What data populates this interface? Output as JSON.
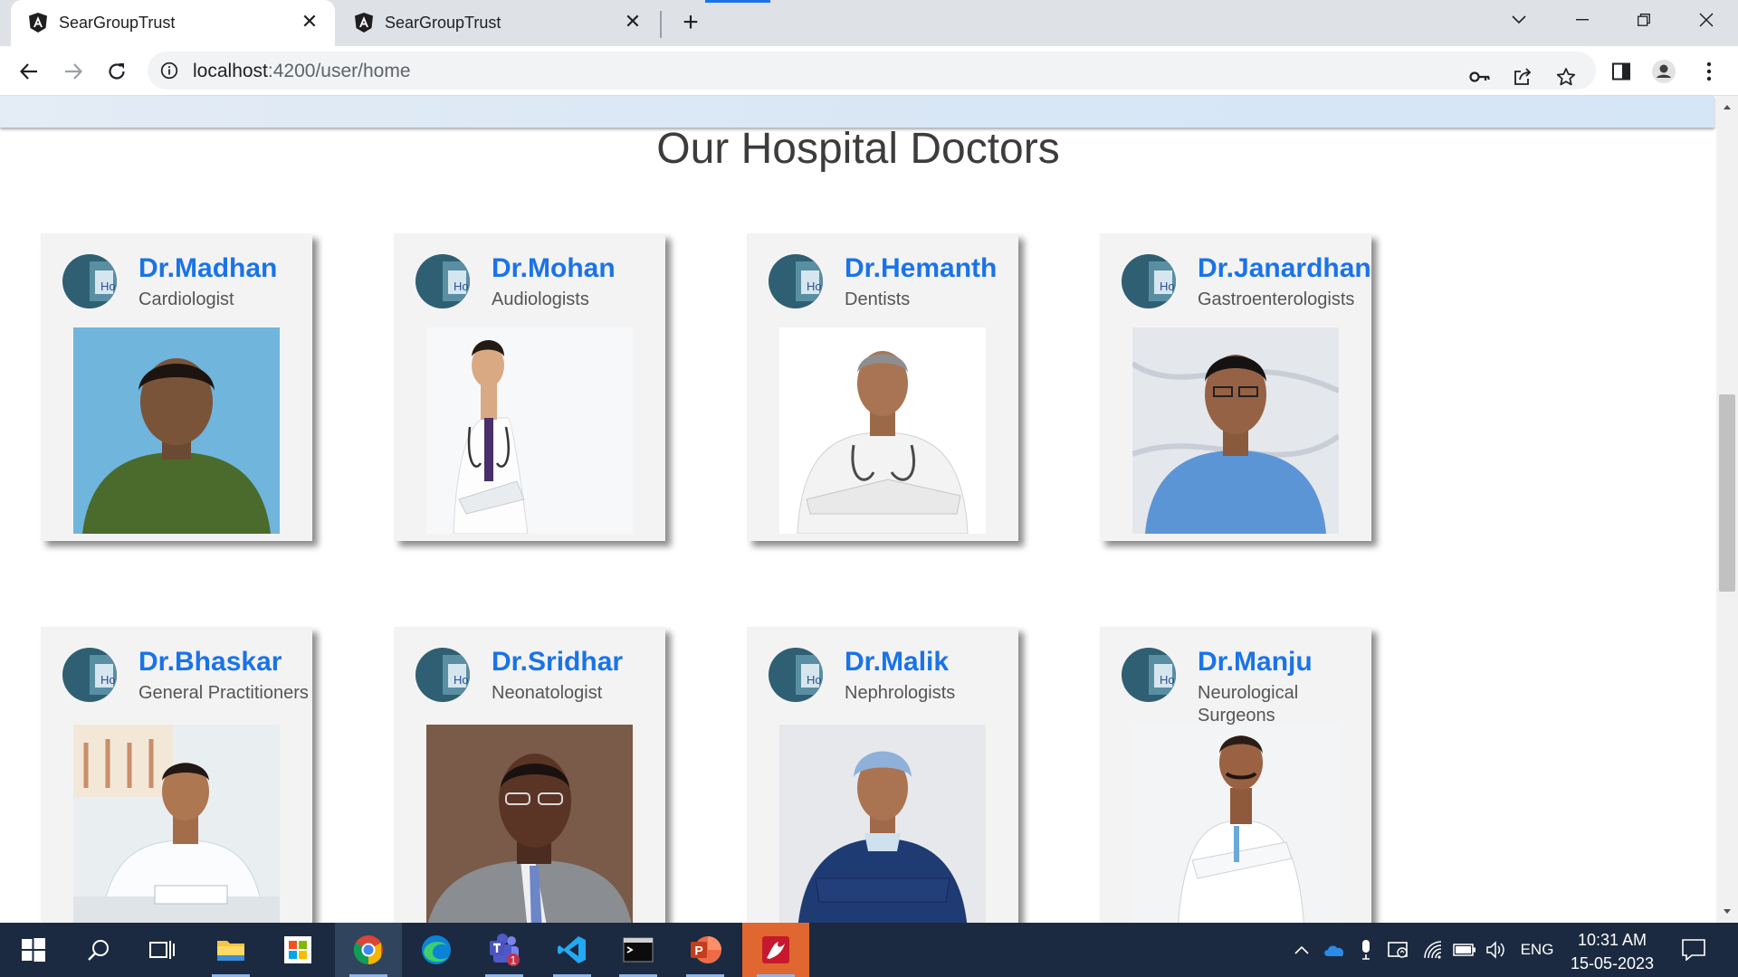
{
  "browser": {
    "tabs": [
      {
        "title": "SearGroupTrust",
        "active": true,
        "favicon": "angular-icon"
      },
      {
        "title": "SearGroupTrust",
        "active": false,
        "favicon": "angular-icon"
      }
    ],
    "url_host": "localhost",
    "url_path": ":4200/user/home"
  },
  "page": {
    "section_title": "Our Hospital Doctors",
    "doctors": [
      {
        "name": "Dr.Madhan",
        "specialty": "Cardiologist"
      },
      {
        "name": "Dr.Mohan",
        "specialty": "Audiologists"
      },
      {
        "name": "Dr.Hemanth",
        "specialty": "Dentists"
      },
      {
        "name": "Dr.Janardhan",
        "specialty": "Gastroenterologists"
      },
      {
        "name": "Dr.Bhaskar",
        "specialty": "General Practitioners"
      },
      {
        "name": "Dr.Sridhar",
        "specialty": "Neonatologist"
      },
      {
        "name": "Dr.Malik",
        "specialty": "Nephrologists"
      },
      {
        "name": "Dr.Manju",
        "specialty": "Neurological Surgeons"
      }
    ],
    "avatar_label": "Hosp"
  },
  "taskbar": {
    "apps": [
      "windows-start-icon",
      "search-icon",
      "task-view-icon",
      "file-explorer-icon",
      "microsoft-store-icon",
      "chrome-icon",
      "edge-icon",
      "teams-icon",
      "vscode-icon",
      "terminal-icon",
      "powerpoint-icon",
      "remote-app-icon"
    ],
    "teams_badge": "1",
    "language": "ENG",
    "time": "10:31 AM",
    "date": "15-05-2023"
  },
  "colors": {
    "accent": "#1a73e8",
    "taskbar": "#1b2a40",
    "card_bg": "#f3f3f3"
  }
}
